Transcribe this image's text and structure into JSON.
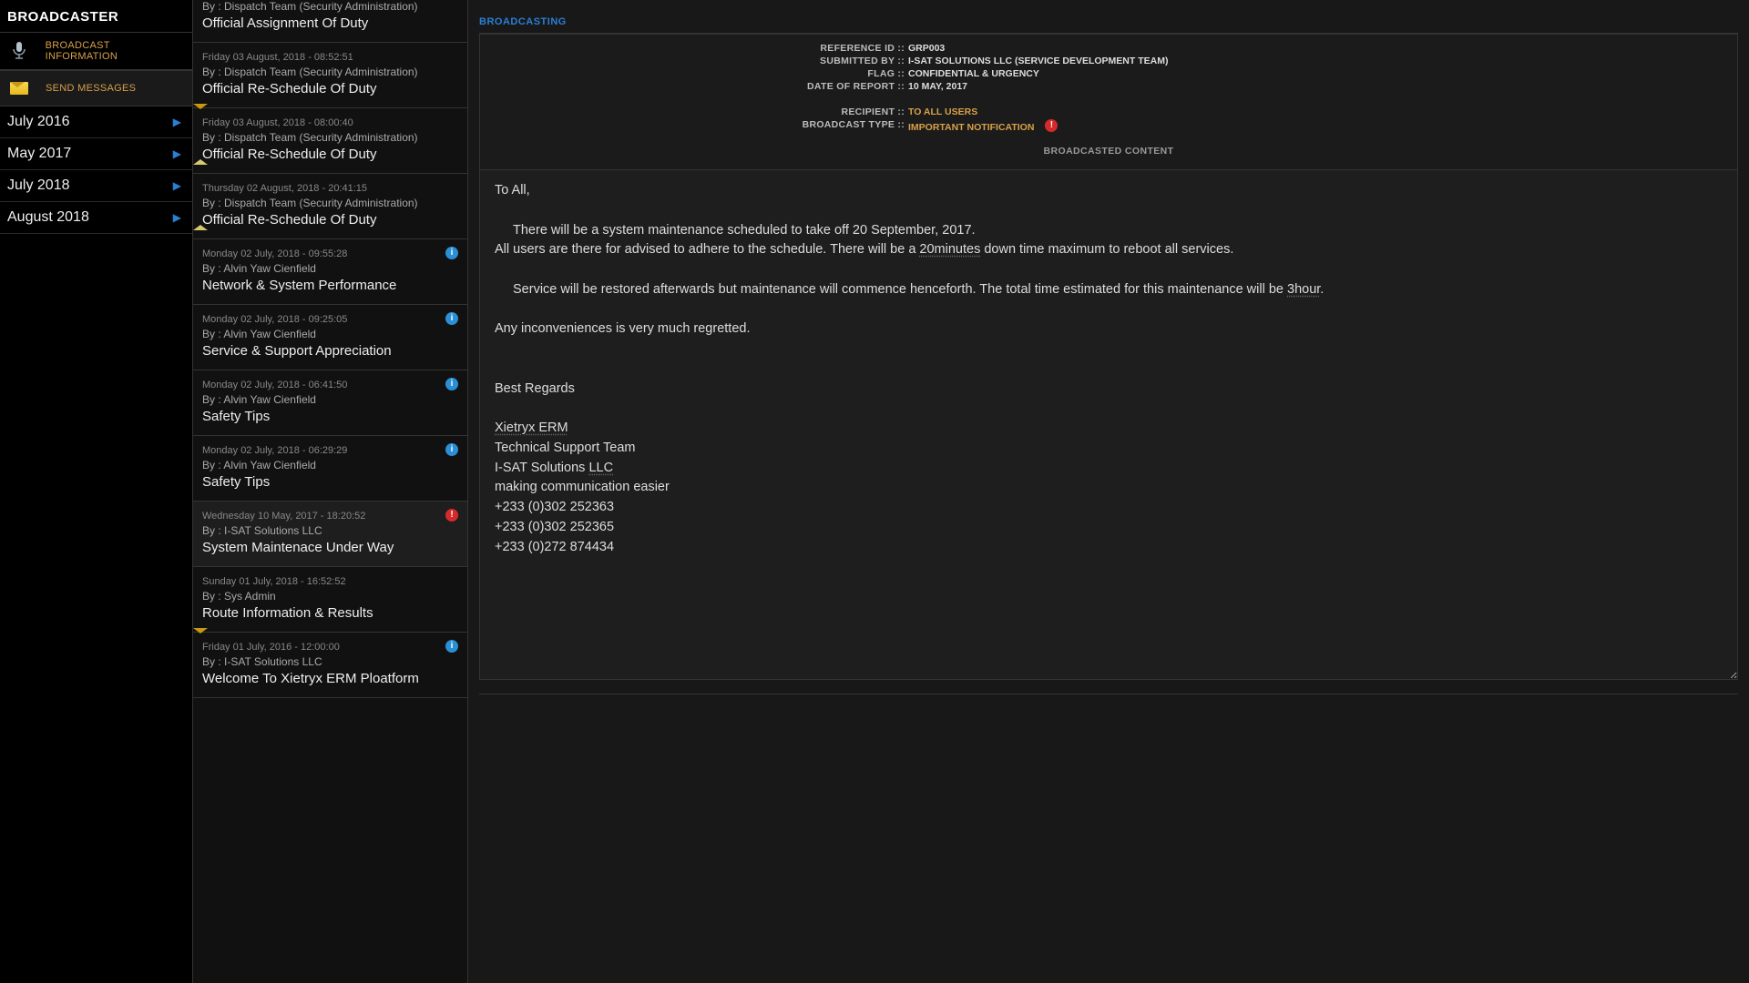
{
  "app": {
    "title": "BROADCASTER"
  },
  "nav": {
    "broadcast_info": "BROADCAST INFORMATION",
    "send_messages": "SEND MESSAGES"
  },
  "months": [
    {
      "label": "July 2016"
    },
    {
      "label": "May 2017"
    },
    {
      "label": "July 2018"
    },
    {
      "label": "August 2018"
    }
  ],
  "messages": [
    {
      "date": "",
      "by": "By : Dispatch Team (Security Administration)",
      "title": "Official Assignment Of Duty",
      "icon": "none",
      "partial_top": true
    },
    {
      "date": "Friday 03 August, 2018 - 08:52:51",
      "by": "By : Dispatch Team (Security Administration)",
      "title": "Official Re-Schedule Of Duty",
      "icon": "closed"
    },
    {
      "date": "Friday 03 August, 2018 - 08:00:40",
      "by": "By : Dispatch Team (Security Administration)",
      "title": "Official Re-Schedule Of Duty",
      "icon": "open"
    },
    {
      "date": "Thursday 02 August, 2018 - 20:41:15",
      "by": "By : Dispatch Team (Security Administration)",
      "title": "Official Re-Schedule Of Duty",
      "icon": "open"
    },
    {
      "date": "Monday 02 July, 2018 - 09:55:28",
      "by": "By : Alvin Yaw Cienfield",
      "title": "Network & System Performance",
      "icon": "info"
    },
    {
      "date": "Monday 02 July, 2018 - 09:25:05",
      "by": "By : Alvin Yaw Cienfield",
      "title": "Service & Support Appreciation",
      "icon": "info"
    },
    {
      "date": "Monday 02 July, 2018 - 06:41:50",
      "by": "By : Alvin Yaw Cienfield",
      "title": "Safety Tips",
      "icon": "info"
    },
    {
      "date": "Monday 02 July, 2018 - 06:29:29",
      "by": "By : Alvin Yaw Cienfield",
      "title": "Safety Tips",
      "icon": "info"
    },
    {
      "date": "Wednesday 10 May, 2017 - 18:20:52",
      "by": "By : I-SAT Solutions LLC",
      "title": "System Maintenace Under Way",
      "icon": "important",
      "selected": true
    },
    {
      "date": "Sunday 01 July, 2018 - 16:52:52",
      "by": "By : Sys Admin",
      "title": "Route Information & Results",
      "icon": "closed"
    },
    {
      "date": "Friday 01 July, 2016 - 12:00:00",
      "by": "By : I-SAT Solutions LLC",
      "title": "Welcome To Xietryx ERM Ploatform",
      "icon": "info"
    }
  ],
  "detail": {
    "header": "BROADCASTING",
    "labels": {
      "reference_id": "REFERENCE ID ::",
      "submitted_by": "SUBMITTED BY ::",
      "flag": "FLAG ::",
      "date_of_report": "DATE OF REPORT ::",
      "recipient": "RECIPIENT ::",
      "broadcast_type": "BROADCAST TYPE ::",
      "broadcasted_content": "BROADCASTED CONTENT"
    },
    "reference_id": "GRP003",
    "submitted_by": "I-SAT SOLUTIONS LLC (SERVICE DEVELOPMENT TEAM)",
    "flag": "CONFIDENTIAL & URGENCY",
    "date_of_report": "10 MAY, 2017",
    "recipient": "TO ALL USERS",
    "broadcast_type": "IMPORTANT NOTIFICATION",
    "content": {
      "greeting": "To All,",
      "p1a": "There will be a system maintenance scheduled to take off 20 September, 2017.",
      "p1b_pre": "All users are there for advised to adhere to the schedule. There will be a ",
      "p1b_ul": "20minutes",
      "p1b_post": " down time maximum to reboot all services.",
      "p2_pre": "Service will be restored afterwards but maintenance will commence henceforth. The total time estimated for this maintenance will be ",
      "p2_ul": "3hour",
      "p2_post": ".",
      "p3": "Any inconveniences is very much regretted.",
      "sig1": "Best Regards",
      "sig2a": "Xietryx ",
      "sig2b": "ERM",
      "sig3": "Technical Support Team",
      "sig4a": "I-SAT Solutions ",
      "sig4b": "LLC",
      "sig5": "making communication easier",
      "sig6": "+233 (0)302 252363",
      "sig7": "+233 (0)302 252365",
      "sig8": "+233 (0)272 874434"
    }
  }
}
